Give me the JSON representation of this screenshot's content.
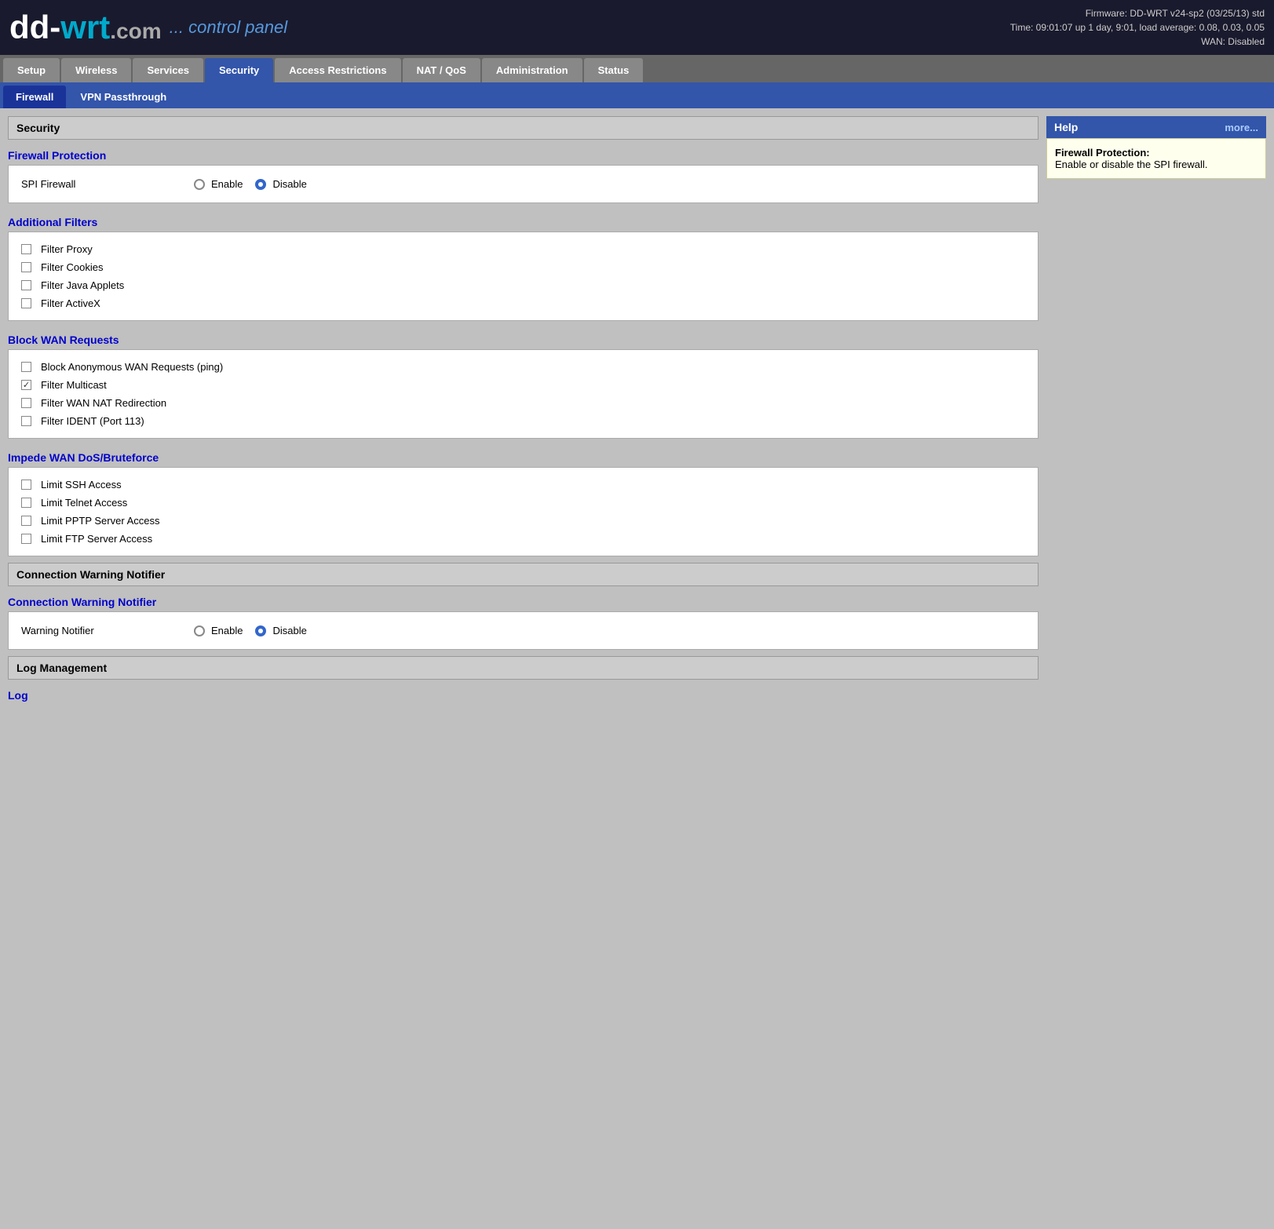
{
  "header": {
    "logo": "dd-wrt.com",
    "subtitle": "... control panel",
    "firmware": "Firmware: DD-WRT v24-sp2 (03/25/13) std",
    "time": "Time: 09:01:07 up 1 day, 9:01, load average: 0.08, 0.03, 0.05",
    "wan": "WAN: Disabled"
  },
  "nav": {
    "tabs": [
      {
        "label": "Setup",
        "active": false
      },
      {
        "label": "Wireless",
        "active": false
      },
      {
        "label": "Services",
        "active": false
      },
      {
        "label": "Security",
        "active": true
      },
      {
        "label": "Access Restrictions",
        "active": false
      },
      {
        "label": "NAT / QoS",
        "active": false
      },
      {
        "label": "Administration",
        "active": false
      },
      {
        "label": "Status",
        "active": false
      }
    ],
    "subtabs": [
      {
        "label": "Firewall",
        "active": true
      },
      {
        "label": "VPN Passthrough",
        "active": false
      }
    ]
  },
  "main": {
    "section_title": "Security",
    "firewall_protection": {
      "title": "Firewall Protection",
      "label": "SPI Firewall",
      "enable_label": "Enable",
      "disable_label": "Disable",
      "selected": "disable"
    },
    "additional_filters": {
      "title": "Additional Filters",
      "items": [
        {
          "label": "Filter Proxy",
          "checked": false
        },
        {
          "label": "Filter Cookies",
          "checked": false
        },
        {
          "label": "Filter Java Applets",
          "checked": false
        },
        {
          "label": "Filter ActiveX",
          "checked": false
        }
      ]
    },
    "block_wan": {
      "title": "Block WAN Requests",
      "items": [
        {
          "label": "Block Anonymous WAN Requests (ping)",
          "checked": false
        },
        {
          "label": "Filter Multicast",
          "checked": true
        },
        {
          "label": "Filter WAN NAT Redirection",
          "checked": false
        },
        {
          "label": "Filter IDENT (Port 113)",
          "checked": false
        }
      ]
    },
    "impede_wan": {
      "title": "Impede WAN DoS/Bruteforce",
      "items": [
        {
          "label": "Limit SSH Access",
          "checked": false
        },
        {
          "label": "Limit Telnet Access",
          "checked": false
        },
        {
          "label": "Limit PPTP Server Access",
          "checked": false
        },
        {
          "label": "Limit FTP Server Access",
          "checked": false
        }
      ]
    },
    "connection_warning": {
      "section_header": "Connection Warning Notifier",
      "title": "Connection Warning Notifier",
      "label": "Warning Notifier",
      "enable_label": "Enable",
      "disable_label": "Disable",
      "selected": "disable"
    },
    "log_management": {
      "section_header": "Log Management",
      "title": "Log"
    }
  },
  "help": {
    "title": "Help",
    "more_label": "more...",
    "content_title": "Firewall Protection:",
    "content_body": "Enable or disable the SPI firewall."
  }
}
